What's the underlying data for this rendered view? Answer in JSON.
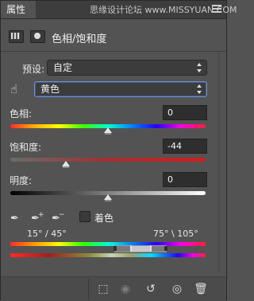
{
  "panel": {
    "tab_label": "属性",
    "watermark": "思缘设计论坛 www.MISSYUAN.COM"
  },
  "header": {
    "title": "色相/饱和度",
    "adjust_icon": "hue-saturation-icon",
    "mask_icon": "mask-icon"
  },
  "preset": {
    "label": "预设:",
    "value": "自定"
  },
  "channel": {
    "value": "黄色",
    "hand_icon": "targeted-adjust-hand-icon"
  },
  "hue": {
    "label": "色相:",
    "value": "0",
    "level": 0
  },
  "saturation": {
    "label": "饱和度:",
    "value": "-44",
    "level": -44
  },
  "lightness": {
    "label": "明度:",
    "value": "0",
    "level": 0
  },
  "colorize": {
    "label": "着色",
    "checked": false
  },
  "range": {
    "left_label": "15° / 45°",
    "right_label": "75° \\ 105°"
  },
  "footer": {
    "clip_icon": "clip-to-layer-icon",
    "view_prev_icon": "view-previous-state-icon",
    "reset_icon": "reset-icon",
    "visibility_icon": "eye-icon",
    "delete_icon": "trash-icon"
  }
}
